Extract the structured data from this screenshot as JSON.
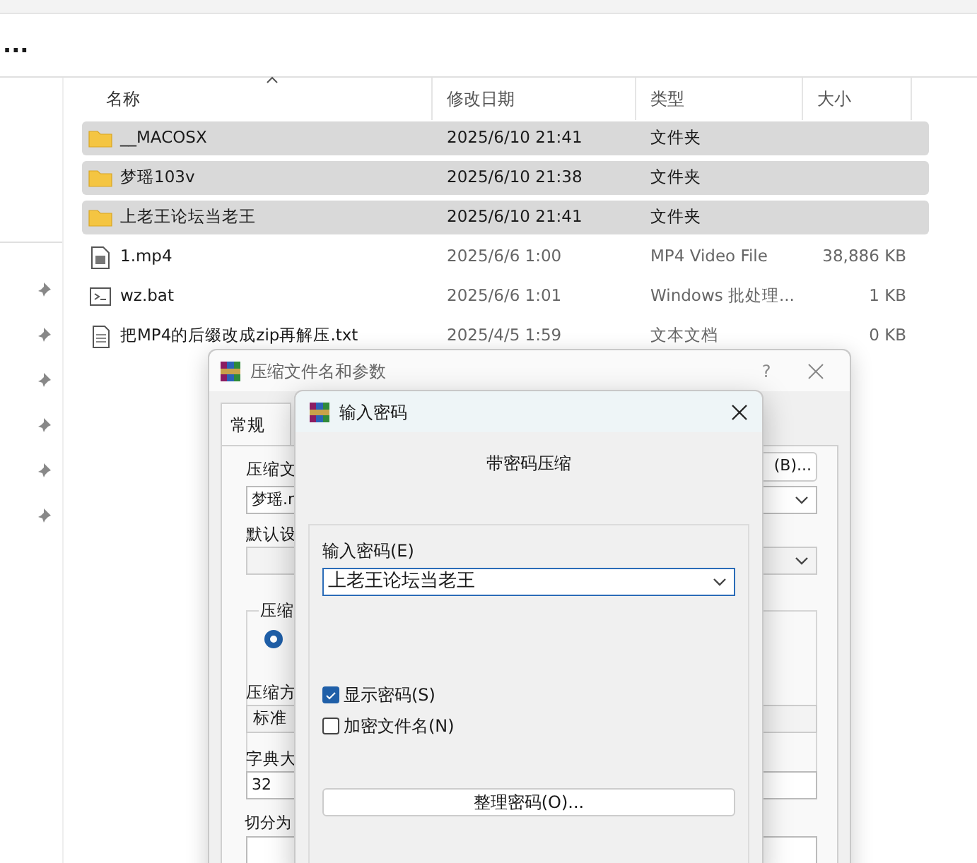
{
  "explorer": {
    "more": "...",
    "columns": [
      {
        "label": "名称",
        "sorted": true
      },
      {
        "label": "修改日期",
        "sorted": false
      },
      {
        "label": "类型",
        "sorted": false
      },
      {
        "label": "大小",
        "sorted": false
      }
    ],
    "rows": [
      {
        "name": "__MACOSX",
        "date": "2025/6/10 21:41",
        "type": "文件夹",
        "size": "",
        "kind": "folder",
        "selected": true
      },
      {
        "name": "梦瑶103v",
        "date": "2025/6/10 21:38",
        "type": "文件夹",
        "size": "",
        "kind": "folder",
        "selected": true
      },
      {
        "name": "上老王论坛当老王",
        "date": "2025/6/10 21:41",
        "type": "文件夹",
        "size": "",
        "kind": "folder",
        "selected": true
      },
      {
        "name": "1.mp4",
        "date": "2025/6/6 1:00",
        "type": "MP4 Video File",
        "size": "38,886 KB",
        "kind": "video",
        "selected": false
      },
      {
        "name": "wz.bat",
        "date": "2025/6/6 1:01",
        "type": "Windows 批处理...",
        "size": "1 KB",
        "kind": "script",
        "selected": false
      },
      {
        "name": "把MP4的后缀改成zip再解压.txt",
        "date": "2025/4/5 1:59",
        "type": "文本文档",
        "size": "0 KB",
        "kind": "text",
        "selected": false
      }
    ]
  },
  "archive_dialog": {
    "title": "压缩文件名和参数",
    "help": "?",
    "tabs": [
      {
        "label": "常规",
        "selected": true
      }
    ],
    "browse_button": "(B)...",
    "name_label": "压缩文",
    "name_value": "梦瑶.r",
    "profile_label": "默认设",
    "format_group": "压缩",
    "format_radio_selected": true,
    "method_label": "压缩方",
    "method_value": "标准",
    "dict_label": "字典大",
    "dict_value": "32",
    "split_label": "切分为"
  },
  "password_dialog": {
    "title": "输入密码",
    "heading": "带密码压缩",
    "field_label": "输入密码(E)",
    "value": "上老王论坛当老王",
    "checkboxes": [
      {
        "label": "显示密码(S)",
        "checked": true
      },
      {
        "label": "加密文件名(N)",
        "checked": false
      }
    ],
    "button": "整理密码(O)..."
  }
}
